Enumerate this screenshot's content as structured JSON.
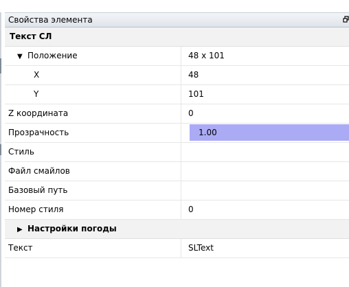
{
  "panel": {
    "title": "Свойства элемента",
    "dock_icon": "float-window-icon"
  },
  "group_title": "Текст СЛ",
  "properties": {
    "position": {
      "arrow": "▼",
      "label": "Положение",
      "value": "48 x 101"
    },
    "x": {
      "label": "X",
      "value": "48"
    },
    "y": {
      "label": "Y",
      "value": "101"
    },
    "z": {
      "label": "Z координата",
      "value": "0"
    },
    "opacity": {
      "label": "Прозрачность",
      "value": "1.00"
    },
    "style": {
      "label": "Стиль",
      "value": ""
    },
    "smiley_file": {
      "label": "Файл смайлов",
      "value": ""
    },
    "base_path": {
      "label": "Базовый путь",
      "value": ""
    },
    "style_number": {
      "label": "Номер стиля",
      "value": "0"
    },
    "weather": {
      "arrow": "▶",
      "label": "Настройки погоды"
    },
    "text": {
      "label": "Текст",
      "value": "SLText"
    }
  },
  "colors": {
    "selected_value": "#ababf5",
    "category_bg": "#f2f2f2",
    "header_bg": "#e4e8ed"
  }
}
